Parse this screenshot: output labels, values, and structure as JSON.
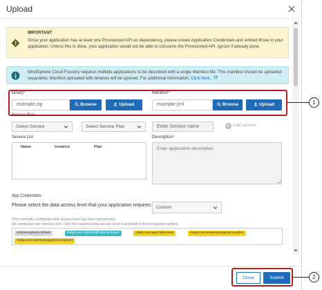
{
  "dialog": {
    "title": "Upload"
  },
  "warning": {
    "heading": "IMPORTANT",
    "text": "Since your application has at least one Provisioned API as dependency, please create Application Credentials and embed those in your application. Unless this is done, your application would not be able to consume the Provisioned API. Ignore if already done."
  },
  "info": {
    "text": "MindSphere Cloud Foundry requires multiple applications to be described with a single Manifest file. This manifest should be uploaded separately. Manifest uploaded with binaries will be ignored. For additional information,",
    "link": "Click here.."
  },
  "binary": {
    "label": "Binary",
    "placeholder": "example.zip",
    "browse": "Browse",
    "upload": "Upload"
  },
  "manifest": {
    "label": "Manifest",
    "placeholder": "example.yml",
    "browse": "Browse",
    "upload": "Upload"
  },
  "service_plan": {
    "label": "Service Plan",
    "select_service": "Select Service",
    "select_plan": "Select Service Plan",
    "name_placeholder": "Enter Service name",
    "add": "Add service"
  },
  "service_list": {
    "label": "Service List",
    "columns": [
      "Name",
      "Instance",
      "Plan"
    ]
  },
  "description": {
    "label": "Description",
    "placeholder": "Enter application description"
  },
  "app_credentials": {
    "heading": "App Credentials",
    "question": "Please select the data access level that your application requires:",
    "selected": "Custom",
    "note_line1": "Your currently configured data access level has been preselected.",
    "note_line2": "No credentials are handed over. Only the required data access level is provided to the production system.",
    "tags": [
      {
        "text": "turbineregisters.default",
        "color": "grey"
      },
      {
        "text": "mdsp:core:Admin3rdPartyTechUser",
        "color": "teal"
      },
      {
        "text": "mdsp:core:agm.fullaccess",
        "color": "yellow"
      },
      {
        "text": "mdsp:core:assetmanagement.admin",
        "color": "yellow"
      },
      {
        "text": "mdsp:core:assetmanagement.reporter",
        "color": "yellow"
      }
    ]
  },
  "footer": {
    "close": "Close",
    "submit": "Submit"
  },
  "callouts": [
    "1",
    "2"
  ],
  "colors": {
    "primary": "#1e6bb8",
    "highlight": "#b01e1e",
    "warning_bg": "#fcf3cf",
    "info_bg": "#d2eef5"
  }
}
